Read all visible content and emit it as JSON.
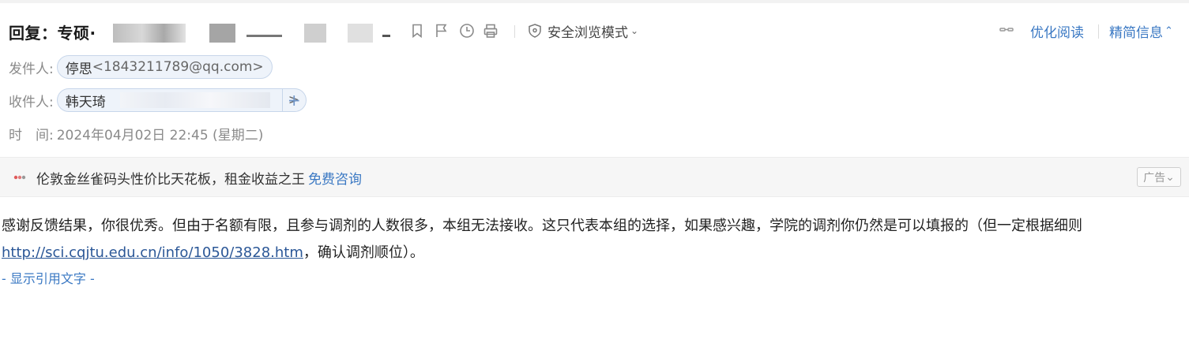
{
  "header": {
    "subject_prefix": "回复：专硕·",
    "safe_mode_label": "安全浏览模式",
    "optimize_read_label": "优化阅读",
    "simple_info_label": "精简信息"
  },
  "meta": {
    "from_label": "发件人:",
    "from_name": "停思",
    "from_email": "<1843211789@qq.com>",
    "to_label": "收件人:",
    "to_name": "韩天琦",
    "to_suffix": ">",
    "time_label": "时　间:",
    "time_value": "2024年04月02日 22:45 (星期二)"
  },
  "ad": {
    "text": "伦敦金丝雀码头性价比天花板，租金收益之王",
    "link": "免费咨询",
    "badge": "广告"
  },
  "body": {
    "text_part1": "感谢反馈结果，你很优秀。但由于名额有限，且参与调剂的人数很多，本组无法接收。这只代表本组的选择，如果感兴趣，学院的调剂你仍然是可以填报的（但一定根据细则",
    "link": "http://sci.cqjtu.edu.cn/info/1050/3828.htm",
    "text_part2": "，确认调剂顺位）。",
    "quote_toggle": "- 显示引用文字 -"
  },
  "colors": {
    "accent": "#3a78c3",
    "chip_bg": "#eef3fa",
    "ad_bg": "#f6f6f6"
  }
}
